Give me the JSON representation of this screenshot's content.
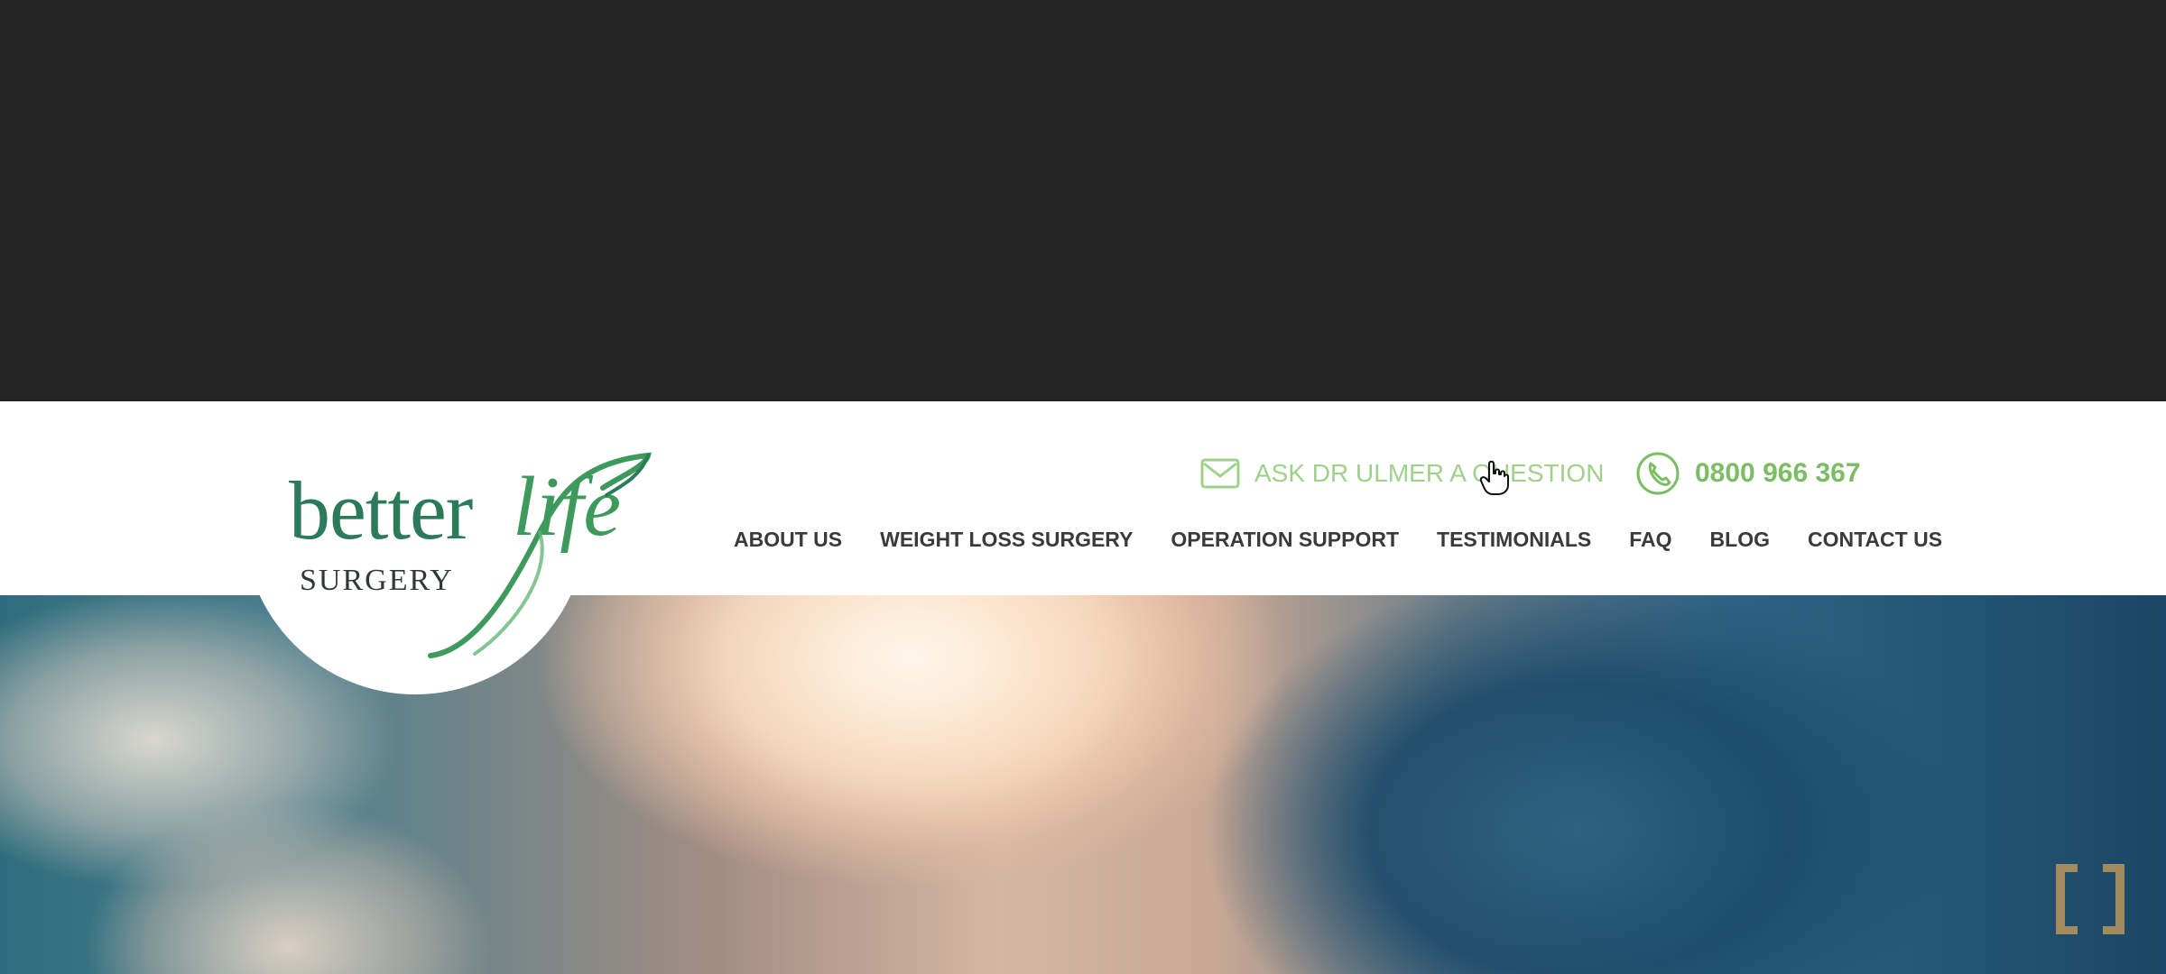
{
  "brand": {
    "name_part_1": "better",
    "name_part_2": "life",
    "subtitle": "SURGERY",
    "primary_green": "#2b7b5b",
    "accent_green": "#7bbd62"
  },
  "header": {
    "ask_question": {
      "icon": "envelope-icon",
      "label": "ASK DR ULMER A QUESTION"
    },
    "phone": {
      "icon": "phone-icon",
      "number": "0800 966 367"
    }
  },
  "nav": {
    "items": [
      "ABOUT US",
      "WEIGHT LOSS SURGERY",
      "OPERATION SUPPORT",
      "TESTIMONIALS",
      "FAQ",
      "BLOG",
      "CONTACT US"
    ]
  },
  "hero": {
    "headline_partial": ""
  },
  "overlay": {
    "icon": "fullscreen-bracket-icon",
    "color": "#a88f5f"
  }
}
